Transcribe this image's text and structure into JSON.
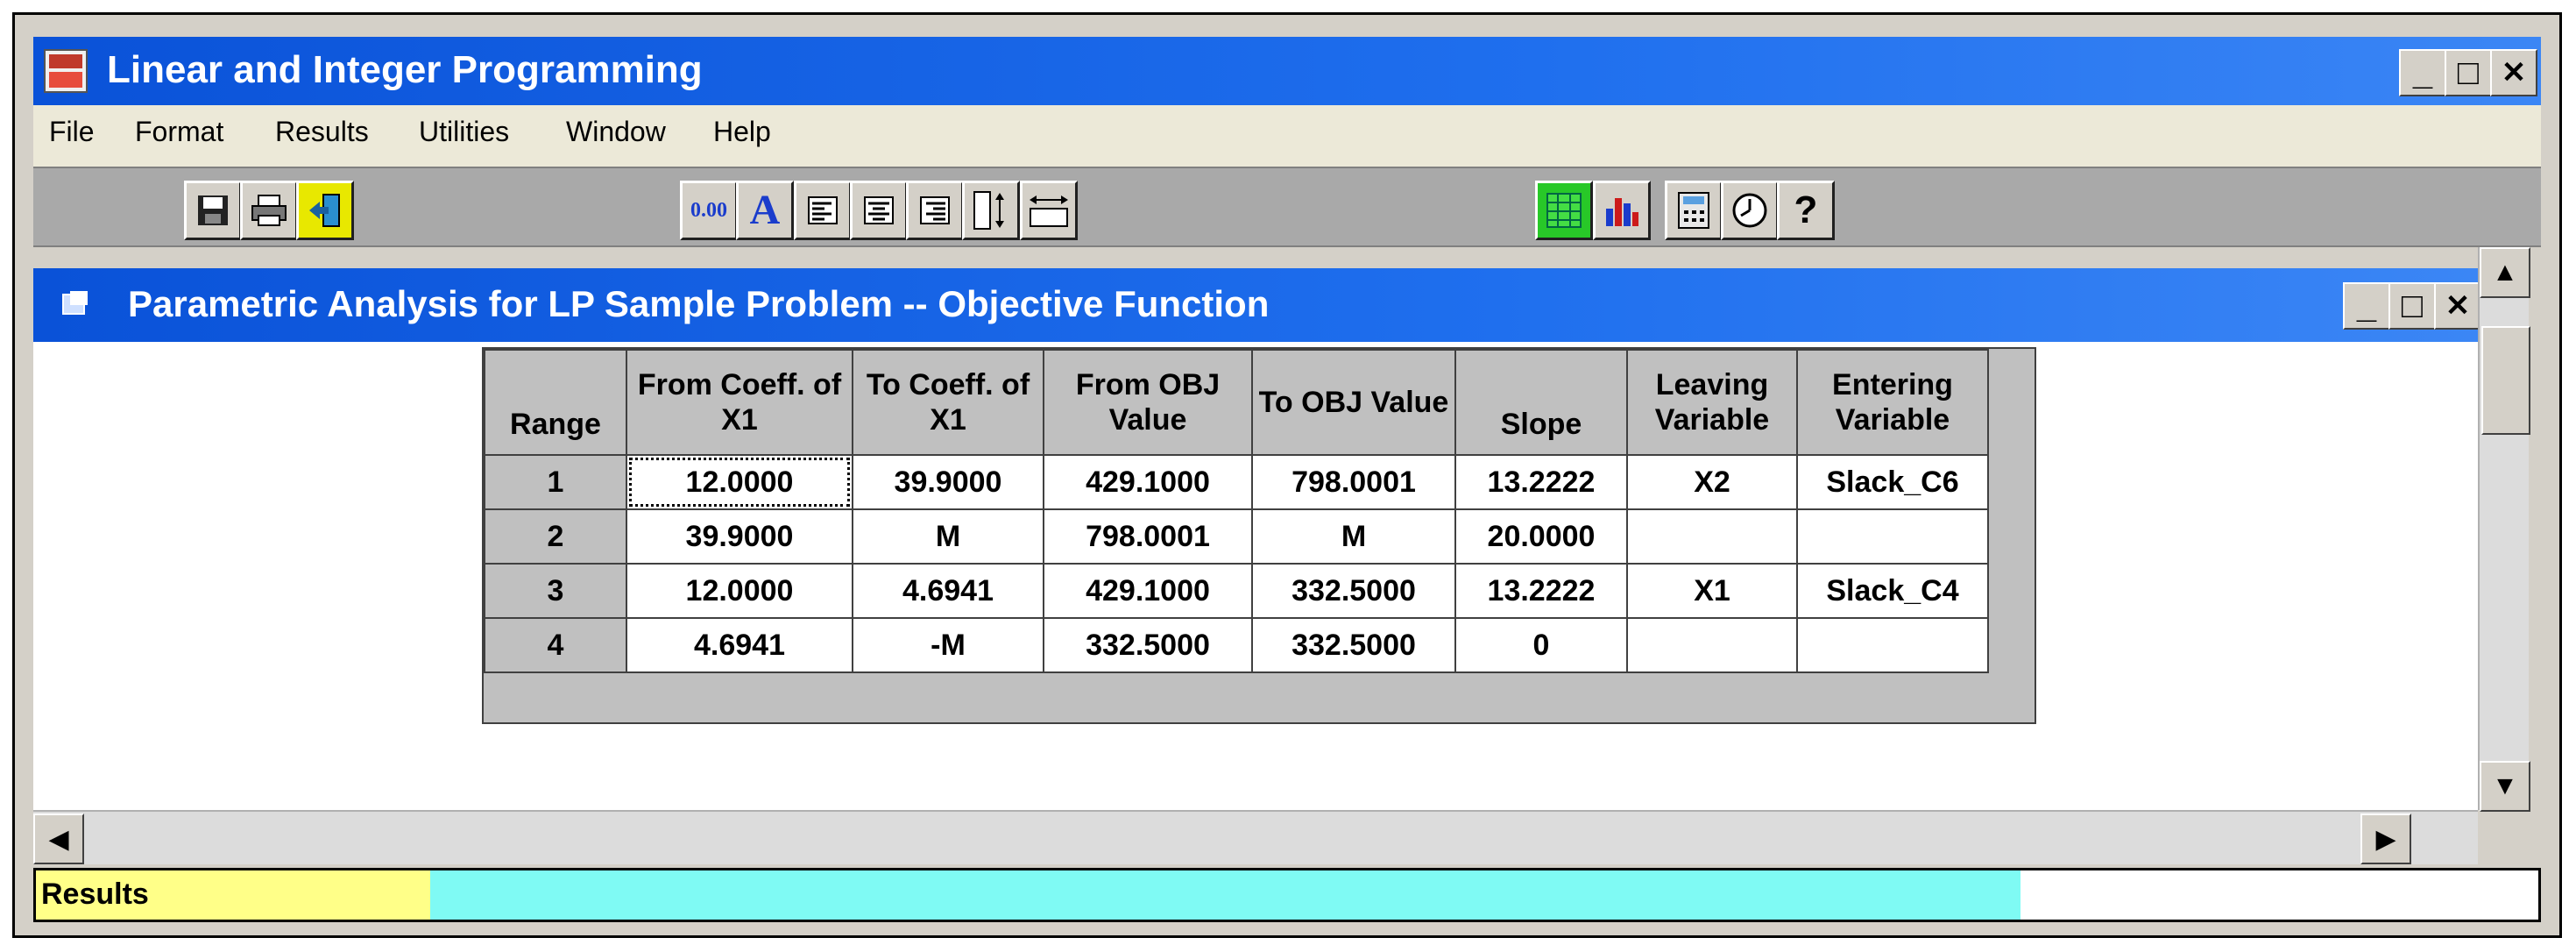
{
  "window": {
    "title": "Linear and Integer Programming",
    "controls": {
      "minimize": "_",
      "maximize": "□",
      "close": "✕"
    }
  },
  "menu": [
    "File",
    "Format",
    "Results",
    "Utilities",
    "Window",
    "Help"
  ],
  "toolbar": {
    "buttons": [
      "save-icon",
      "print-icon",
      "exit-icon",
      "decimal-icon",
      "font-icon",
      "align-left-icon",
      "align-center-icon",
      "align-right-icon",
      "row-height-icon",
      "column-width-icon",
      "grid-icon",
      "bar-chart-icon",
      "calculator-icon",
      "clock-icon",
      "help-icon"
    ],
    "decimal_label": "0.00",
    "font_label": "A",
    "help_label": "?"
  },
  "inner_window": {
    "title": "Parametric Analysis for LP Sample Problem -- Objective Function"
  },
  "table": {
    "headers": [
      "Range",
      "From Coeff. of X1",
      "To Coeff. of X1",
      "From OBJ Value",
      "To OBJ Value",
      "Slope",
      "Leaving Variable",
      "Entering Variable"
    ],
    "rows": [
      [
        "1",
        "12.0000",
        "39.9000",
        "429.1000",
        "798.0001",
        "13.2222",
        "X2",
        "Slack_C6"
      ],
      [
        "2",
        "39.9000",
        "M",
        "798.0001",
        "M",
        "20.0000",
        "",
        ""
      ],
      [
        "3",
        "12.0000",
        "4.6941",
        "429.1000",
        "332.5000",
        "13.2222",
        "X1",
        "Slack_C4"
      ],
      [
        "4",
        "4.6941",
        "-M",
        "332.5000",
        "332.5000",
        "0",
        "",
        ""
      ]
    ]
  },
  "scroll": {
    "up": "▲",
    "down": "▼",
    "left": "◀",
    "right": "▶"
  },
  "status": {
    "label": "Results"
  },
  "colors": {
    "titlebar": "#0a52d8",
    "status_yellow": "#ffff88",
    "status_cyan": "#7ffaf4",
    "toolbar": "#a9a9a9"
  }
}
